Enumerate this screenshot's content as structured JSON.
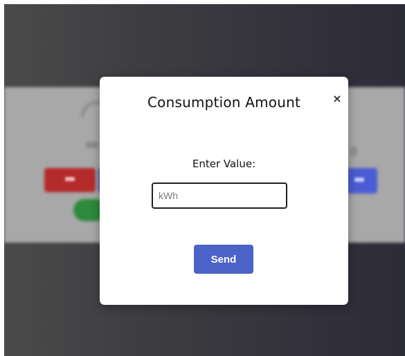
{
  "modal": {
    "title": "Consumption Amount",
    "close_label": "×",
    "field_label": "Enter Value:",
    "input": {
      "value": "",
      "placeholder": "kWh"
    },
    "send_label": "Send"
  },
  "background": {
    "icons": [
      "wifi-icon"
    ],
    "colors": {
      "red_button": "#b52a2a",
      "blue_button": "#4b5cd4",
      "toggle": "#2e8a3c",
      "send_button": "#4b63c6"
    }
  }
}
